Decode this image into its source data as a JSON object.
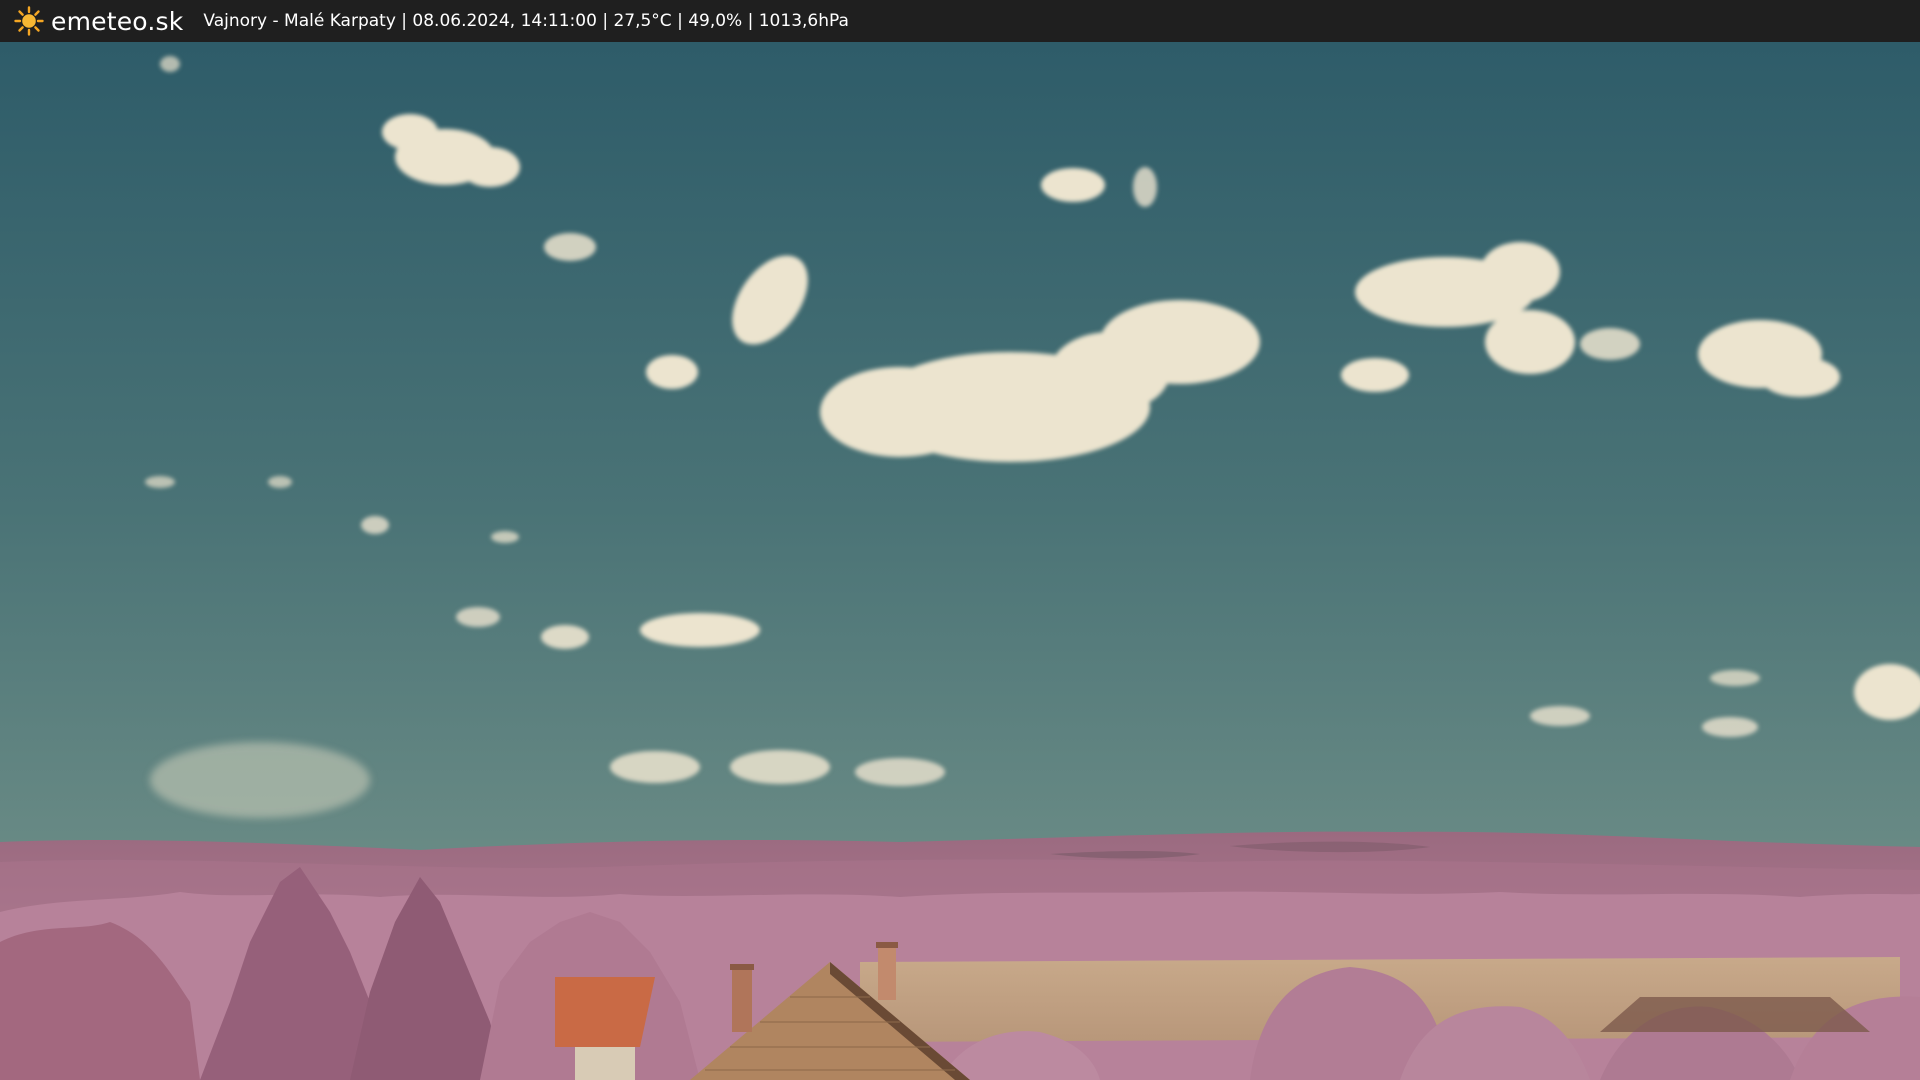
{
  "header": {
    "logo_icon": "sun-icon",
    "brand": "emeteo.sk",
    "caption": "Vajnory - Malé Karpaty | 08.06.2024, 14:11:00 | 27,5°C | 49,0% | 1013,6hPa"
  },
  "colors": {
    "bar_background": "#1f1f1f",
    "sun": "#f5a623",
    "sky_top": "#2f5f6b",
    "sky_bottom": "#6e8e88",
    "foliage": "#b77f96",
    "roof": "#c96a45"
  }
}
